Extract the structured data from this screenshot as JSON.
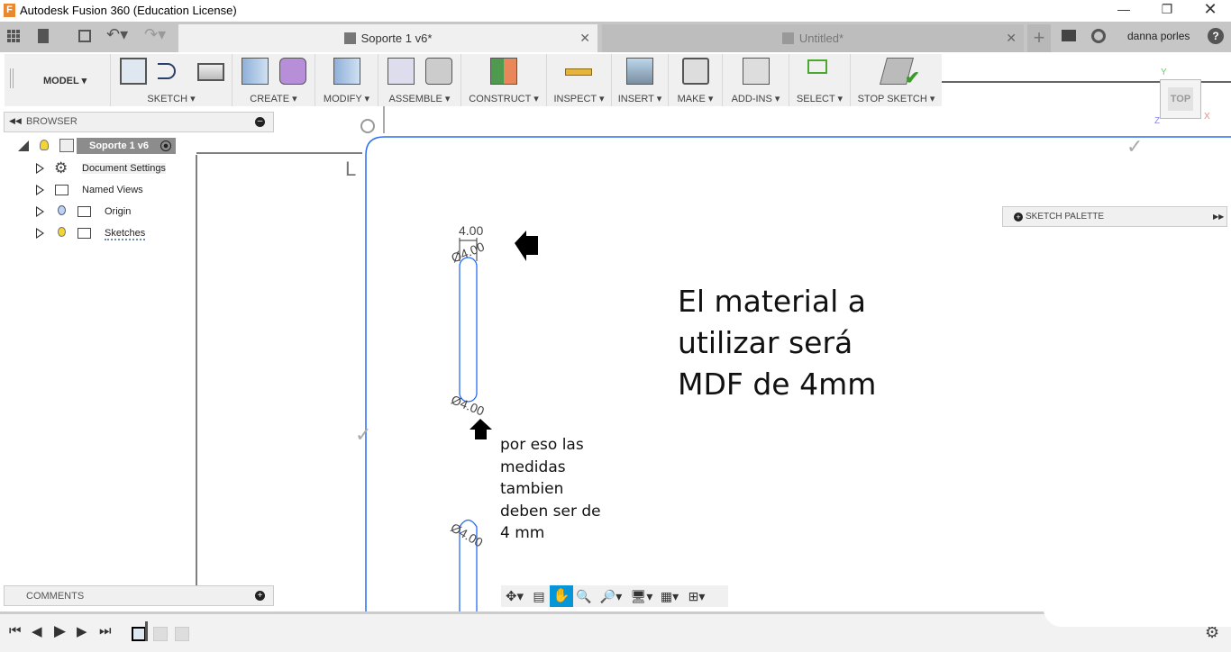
{
  "window": {
    "title": "Autodesk Fusion 360 (Education License)",
    "app_icon": "F"
  },
  "tabs": [
    {
      "label": "Soporte 1 v6*",
      "active": true
    },
    {
      "label": "Untitled*",
      "active": false
    }
  ],
  "user": {
    "name": "danna porles"
  },
  "toolbar": {
    "workspace": "MODEL",
    "groups": [
      "SKETCH",
      "CREATE",
      "MODIFY",
      "ASSEMBLE",
      "CONSTRUCT",
      "INSPECT",
      "INSERT",
      "MAKE",
      "ADD-INS",
      "SELECT",
      "STOP SKETCH"
    ]
  },
  "browser": {
    "title": "BROWSER",
    "root": "Soporte 1 v6",
    "items": [
      "Document Settings",
      "Named Views",
      "Origin",
      "Sketches"
    ]
  },
  "comments": {
    "title": "COMMENTS"
  },
  "sketch_palette": {
    "title": "SKETCH PALETTE"
  },
  "viewcube": {
    "face": "TOP",
    "axes": {
      "y": "Y",
      "x": "X",
      "z": "Z"
    }
  },
  "sketch": {
    "dim_width": "4.00",
    "dim_top": "Ø4.00",
    "dim_bottom": "Ø4.00",
    "dim_third": "Ø4.00"
  },
  "notes": {
    "big": [
      "El material a",
      "utilizar será",
      "MDF de 4mm"
    ],
    "small": [
      "por eso las",
      "medidas",
      "tambien",
      "deben ser de",
      "4 mm"
    ]
  },
  "colors": {
    "accent": "#0696d7",
    "sketch_line": "#2a6cf5",
    "app_icon": "#e8892f"
  }
}
